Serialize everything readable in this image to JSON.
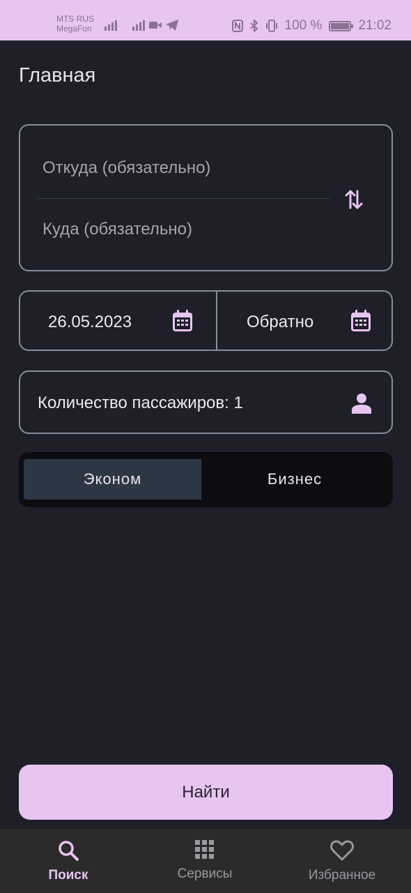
{
  "status_bar": {
    "carrier_1": "MTS RUS",
    "carrier_2": "MegaFon",
    "battery": "100 %",
    "time": "21:02"
  },
  "page": {
    "title": "Главная"
  },
  "route": {
    "from_placeholder": "Откуда (обязательно)",
    "to_placeholder": "Куда (обязательно)"
  },
  "dates": {
    "depart": "26.05.2023",
    "return": "Обратно"
  },
  "passengers": {
    "label": "Количество пассажиров: 1"
  },
  "class_toggle": {
    "options": [
      "Эконом",
      "Бизнес"
    ],
    "selected": "Эконом"
  },
  "actions": {
    "find": "Найти"
  },
  "nav": {
    "items": [
      {
        "label": "Поиск",
        "icon": "search-icon",
        "active": true
      },
      {
        "label": "Сервисы",
        "icon": "grid-icon",
        "active": false
      },
      {
        "label": "Избранное",
        "icon": "heart-icon",
        "active": false
      }
    ]
  },
  "colors": {
    "accent": "#e8c5f1",
    "background": "#1e1f28",
    "outline": "#8b8d9a",
    "selected_segment": "#2d3744"
  }
}
